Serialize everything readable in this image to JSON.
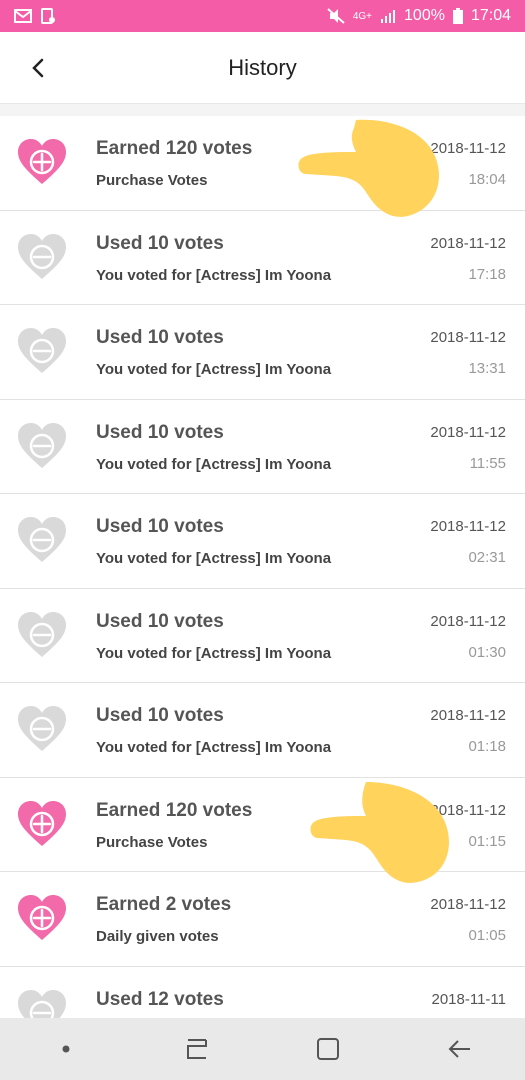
{
  "status_bar": {
    "network": "4G+",
    "battery": "100%",
    "time": "17:04"
  },
  "header": {
    "title": "History"
  },
  "colors": {
    "accent": "#f55ca8",
    "earned_heart": "#f26aa9",
    "used_heart": "#d9d9d9",
    "pointer": "#ffd35c"
  },
  "history": [
    {
      "type": "earned",
      "title": "Earned 120 votes",
      "subtitle": "Purchase Votes",
      "date": "2018-11-12",
      "time": "18:04"
    },
    {
      "type": "used",
      "title": "Used 10 votes",
      "subtitle": "You voted for [Actress] Im Yoona",
      "date": "2018-11-12",
      "time": "17:18"
    },
    {
      "type": "used",
      "title": "Used 10 votes",
      "subtitle": "You voted for [Actress] Im Yoona",
      "date": "2018-11-12",
      "time": "13:31"
    },
    {
      "type": "used",
      "title": "Used 10 votes",
      "subtitle": "You voted for [Actress] Im Yoona",
      "date": "2018-11-12",
      "time": "11:55"
    },
    {
      "type": "used",
      "title": "Used 10 votes",
      "subtitle": "You voted for [Actress] Im Yoona",
      "date": "2018-11-12",
      "time": "02:31"
    },
    {
      "type": "used",
      "title": "Used 10 votes",
      "subtitle": "You voted for [Actress] Im Yoona",
      "date": "2018-11-12",
      "time": "01:30"
    },
    {
      "type": "used",
      "title": "Used 10 votes",
      "subtitle": "You voted for [Actress] Im Yoona",
      "date": "2018-11-12",
      "time": "01:18"
    },
    {
      "type": "earned",
      "title": "Earned 120 votes",
      "subtitle": "Purchase Votes",
      "date": "2018-11-12",
      "time": "01:15"
    },
    {
      "type": "earned",
      "title": "Earned 2 votes",
      "subtitle": "Daily given votes",
      "date": "2018-11-12",
      "time": "01:05"
    },
    {
      "type": "used",
      "title": "Used 12 votes",
      "subtitle": "",
      "date": "2018-11-11",
      "time": ""
    }
  ],
  "nav_icons": [
    "dot-icon",
    "recent-apps-icon",
    "home-icon",
    "back-icon"
  ]
}
